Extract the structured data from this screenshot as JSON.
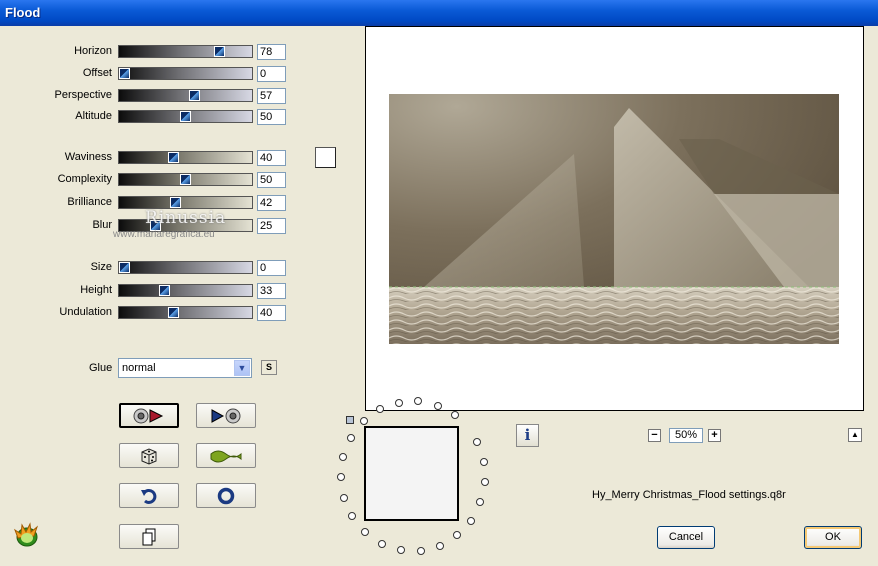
{
  "window": {
    "title": "Flood"
  },
  "sliders": [
    {
      "label": "Horizon",
      "value": "78",
      "level": 78,
      "warm": false
    },
    {
      "label": "Offset",
      "value": "0",
      "level": 0,
      "warm": false
    },
    {
      "label": "Perspective",
      "value": "57",
      "level": 57,
      "warm": false
    },
    {
      "label": "Altitude",
      "value": "50",
      "level": 50,
      "warm": false
    },
    {
      "label": "Waviness",
      "value": "40",
      "level": 40,
      "warm": true
    },
    {
      "label": "Complexity",
      "value": "50",
      "level": 50,
      "warm": true
    },
    {
      "label": "Brilliance",
      "value": "42",
      "level": 42,
      "warm": true
    },
    {
      "label": "Blur",
      "value": "25",
      "level": 25,
      "warm": true
    },
    {
      "label": "Size",
      "value": "0",
      "level": 0,
      "warm": false
    },
    {
      "label": "Height",
      "value": "33",
      "level": 33,
      "warm": false
    },
    {
      "label": "Undulation",
      "value": "40",
      "level": 40,
      "warm": false
    }
  ],
  "glue": {
    "label": "Glue",
    "value": "normal",
    "s_button": "S"
  },
  "watermark": {
    "name": "Rinussia",
    "url": "www.mariaregrafica.eu"
  },
  "preview": {
    "zoom": "50%",
    "info_label": "i"
  },
  "preset": {
    "file_name": "Hy_Merry Christmas_Flood settings.q8r"
  },
  "buttons": {
    "cancel": "Cancel",
    "ok": "OK"
  },
  "icons": {
    "tool_buttons": [
      "apply-to-original-icon",
      "apply-to-preview-icon",
      "random-dice-icon",
      "wave-icon",
      "undo-icon",
      "reset-icon",
      "copy-icon"
    ]
  },
  "colors": {
    "titlebar": "#0a5ad6",
    "dialog_bg": "#ece9d8",
    "slider_thumb": "#0b2b63"
  }
}
